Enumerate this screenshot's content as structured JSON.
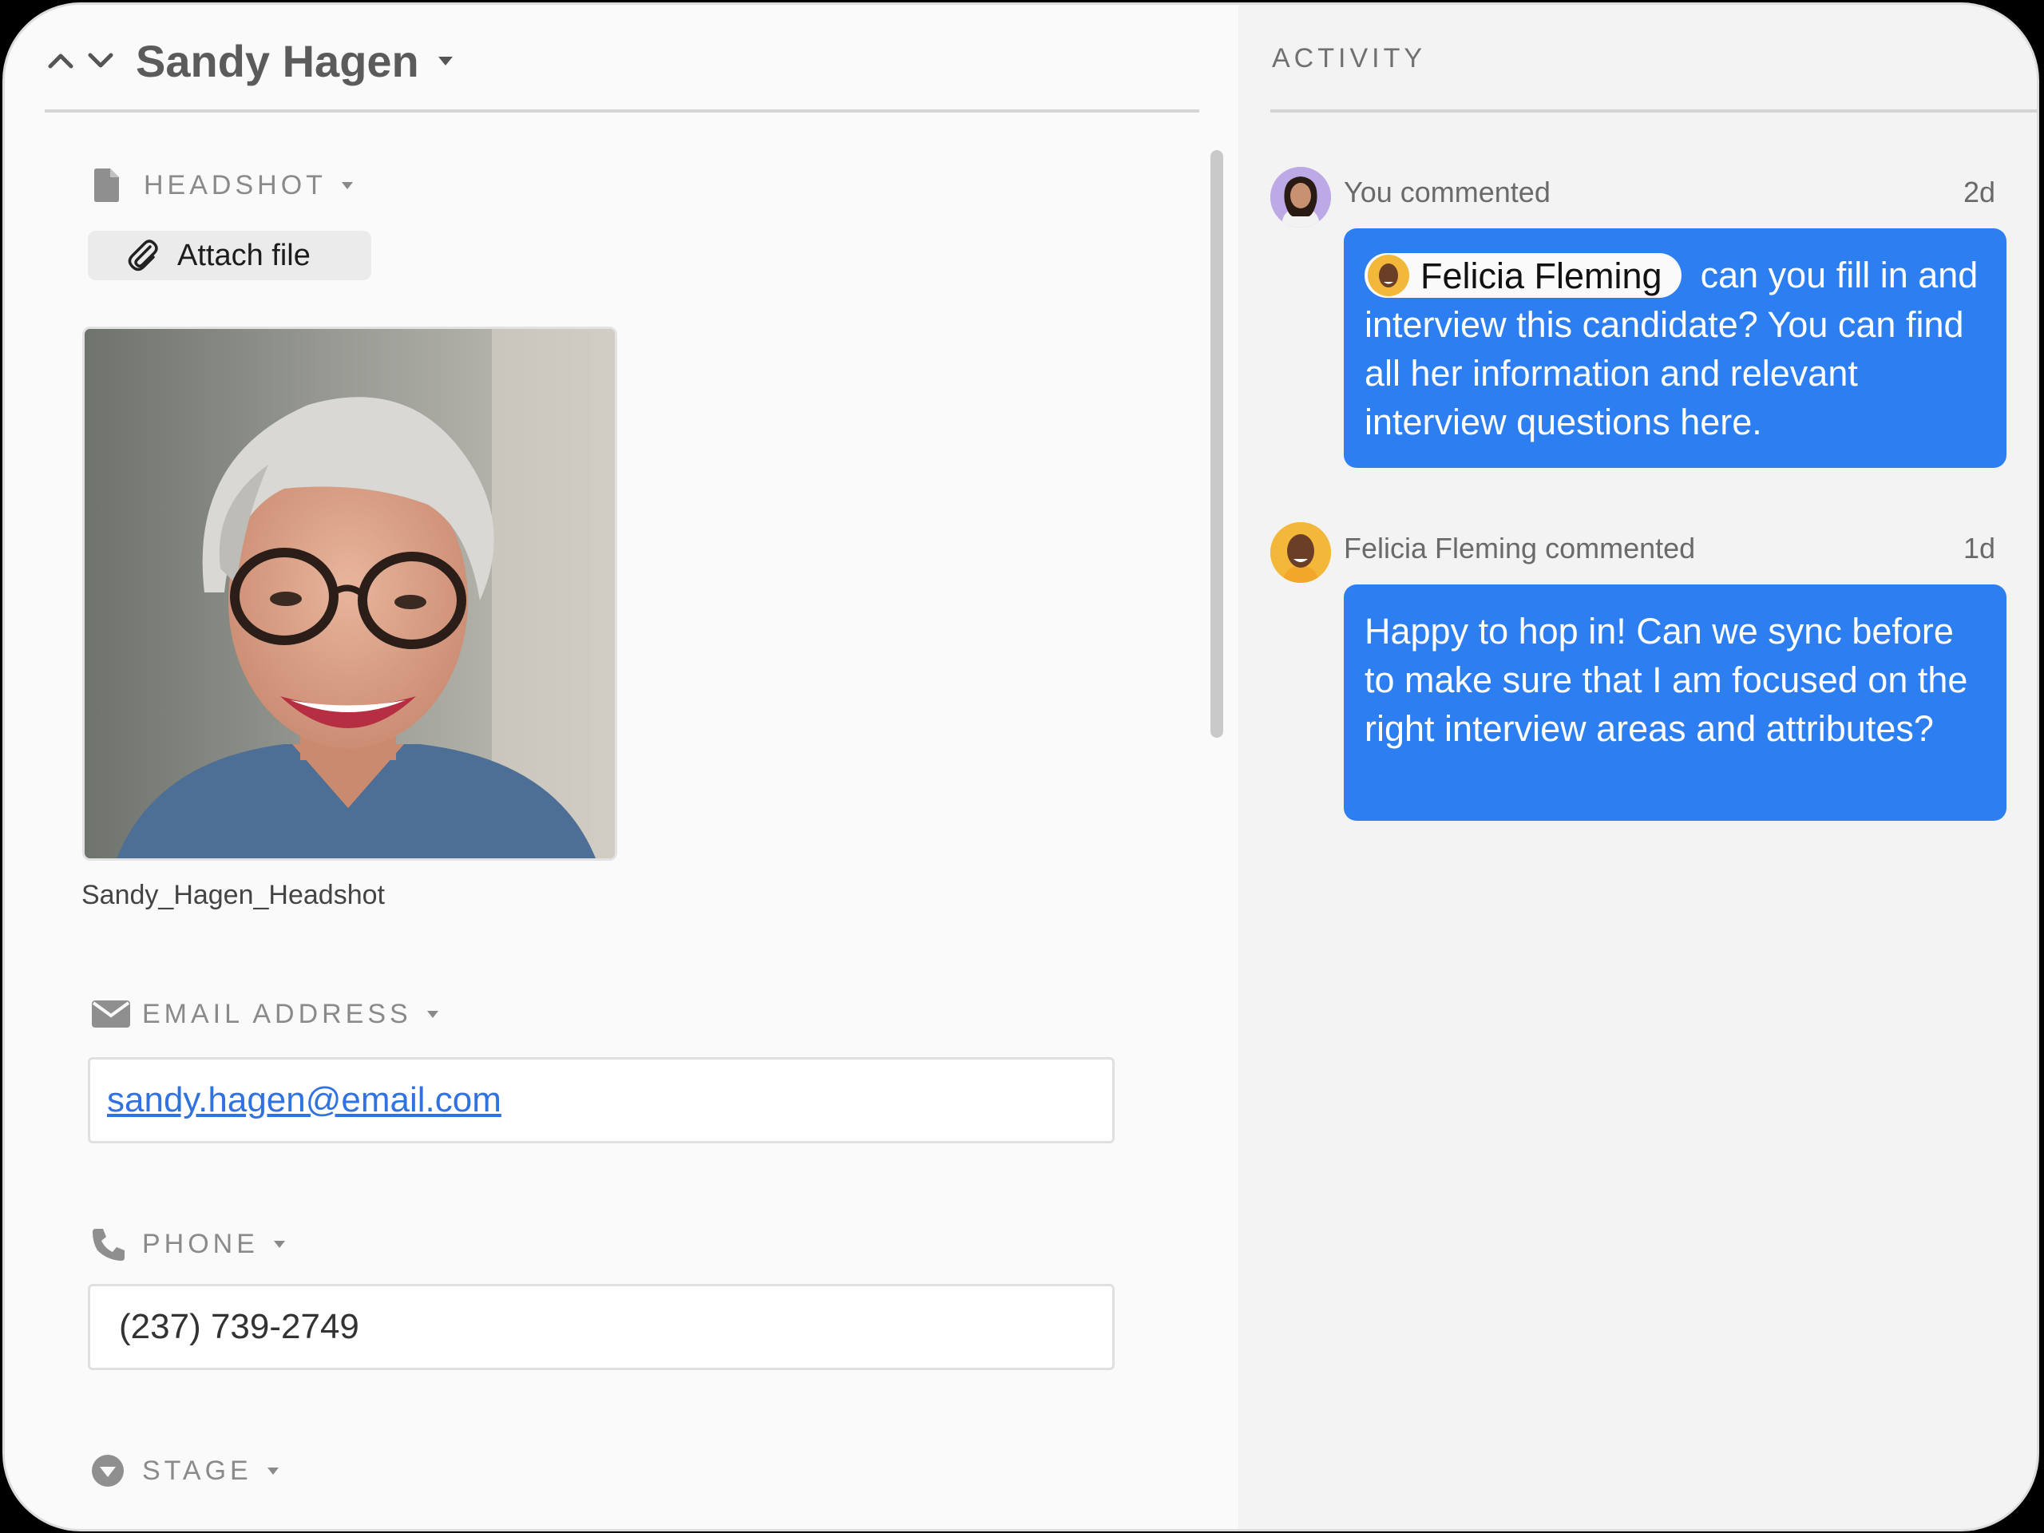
{
  "record": {
    "name": "Sandy Hagen"
  },
  "fields": {
    "headshot": {
      "label": "HEADSHOT",
      "attach_label": "Attach file",
      "filename": "Sandy_Hagen_Headshot"
    },
    "email": {
      "label": "EMAIL ADDRESS",
      "value": "sandy.hagen@email.com"
    },
    "phone": {
      "label": "PHONE",
      "value": "(237) 739-2749"
    },
    "stage": {
      "label": "STAGE"
    }
  },
  "activity": {
    "title": "ACTIVITY",
    "comments": [
      {
        "meta": "You commented",
        "time": "2d",
        "mention": "Felicia Fleming",
        "text": "can you fill in and interview this candidate? You can find all her information and relevant interview questions here."
      },
      {
        "meta": "Felicia Fleming commented",
        "time": "1d",
        "text": "Happy to hop in! Can we sync before to make sure that I am focused on the right interview areas and attributes?"
      }
    ]
  },
  "colors": {
    "accent_blue": "#2d7ff1",
    "link_blue": "#2f72e0",
    "panel_bg": "#fafafa",
    "activity_bg": "#f3f3f3"
  },
  "icons": {
    "nav_up": "chevron-up-icon",
    "nav_down": "chevron-down-icon",
    "headshot": "file-icon",
    "attach": "paperclip-icon",
    "email": "envelope-icon",
    "phone": "phone-icon",
    "stage": "stage-dropdown-icon"
  }
}
